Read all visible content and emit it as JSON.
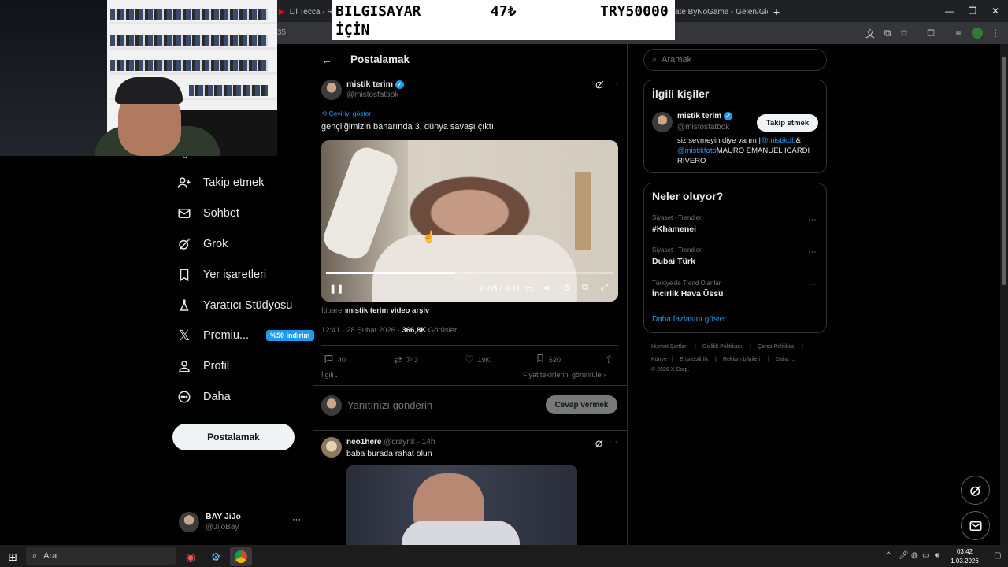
{
  "browser": {
    "tabs": [
      {
        "label": "Lil Tecca - Ranse"
      },
      {
        "label": "ate ByNoGame - Gelen/Gid"
      }
    ],
    "address_fragment": "35"
  },
  "overlay": {
    "line1_left": "BILGISAYAR",
    "line1_mid": "47₺",
    "line1_right": "TRY50000",
    "line2_left": "İÇİN"
  },
  "sidebar": {
    "items": [
      {
        "label": "Takip etmek",
        "icon": "person-plus-icon"
      },
      {
        "label": "Sohbet",
        "icon": "envelope-icon"
      },
      {
        "label": "Grok",
        "icon": "grok-icon"
      },
      {
        "label": "Yer işaretleri",
        "icon": "bookmark-icon"
      },
      {
        "label": "Yaratıcı Stüdyosu",
        "icon": "flask-icon"
      },
      {
        "label": "Premiu...",
        "icon": "x-logo-icon",
        "badge": "%50 İndirim"
      },
      {
        "label": "Profil",
        "icon": "person-icon"
      },
      {
        "label": "Daha",
        "icon": "more-circle-icon"
      }
    ],
    "post_button": "Postalamak",
    "account": {
      "name": "BAY JiJo",
      "handle": "@JijoBay",
      "more": "···"
    }
  },
  "post": {
    "header_title": "Postalamak",
    "author_name": "mistik terim",
    "author_handle": "@mistosfatbok",
    "translate_label": "Çeviriyi göster",
    "text": "gençliğimizin baharında 3. dünya savaşı çıktı",
    "video": {
      "time": "0:05 / 0:11",
      "progress": 0.45,
      "watermark": "ryfyfa"
    },
    "source_prefix": "İtibaren",
    "source_name": "mistik terim video arşiv",
    "timestamp": "12:41 · 28 Şubat 2026 · ",
    "views": "366,8K",
    "views_label": " Görüşler",
    "stats": {
      "replies": "40",
      "reposts": "743",
      "likes": "19K",
      "bookmarks": "620"
    },
    "relevant_label": "İlgili",
    "offers_label": "Fiyat tekliflerini görüntüle",
    "reply_placeholder": "Yanıtınızı gönderin",
    "reply_button": "Cevap vermek"
  },
  "reply": {
    "author_name": "neo1here",
    "author_handle": "@craynk",
    "time": " · 14h",
    "text": "baba burada rahat olun"
  },
  "right": {
    "search_placeholder": "Aramak",
    "related_title": "İlgili kişiler",
    "related": {
      "name": "mistik terim",
      "handle": "@mistosfatbok",
      "follow": "Takip etmek",
      "bio_1": "siz sevmeyin diye varım |",
      "bio_link1": "@mistikdb",
      "bio_amp": "&",
      "bio_link2": "@mistikfoto",
      "bio_2": "MAURO EMANUEL ICARDI",
      "bio_3": "RIVERO"
    },
    "trends_title": "Neler oluyor?",
    "trends": [
      {
        "category": "Siyaset · Trendler",
        "name": "#Khamenei"
      },
      {
        "category": "Siyaset · Trendler",
        "name": "Dubai Türk"
      },
      {
        "category": "Türkiye'de Trend Olanlar",
        "name": "İncirlik Hava Üssü"
      }
    ],
    "show_more": "Daha fazlasını göster",
    "footer": {
      "links_row1": [
        "Hizmet Şartları",
        "|",
        "Gizlilik Politikası",
        "|",
        "Çerez Politikası",
        "|"
      ],
      "links_row2": [
        "Künye",
        "|",
        "Erişilebilirlik",
        "|",
        "Reklam bilgileri",
        "|",
        "Daha ..."
      ],
      "copyright": "© 2026 X Corp."
    }
  },
  "taskbar": {
    "search_label": "Ara",
    "time": "03:42",
    "date": "1.03.2026"
  },
  "colors": {
    "accent": "#1d9bf0",
    "badge": "#1d9bf0",
    "divider": "#2f3336"
  }
}
